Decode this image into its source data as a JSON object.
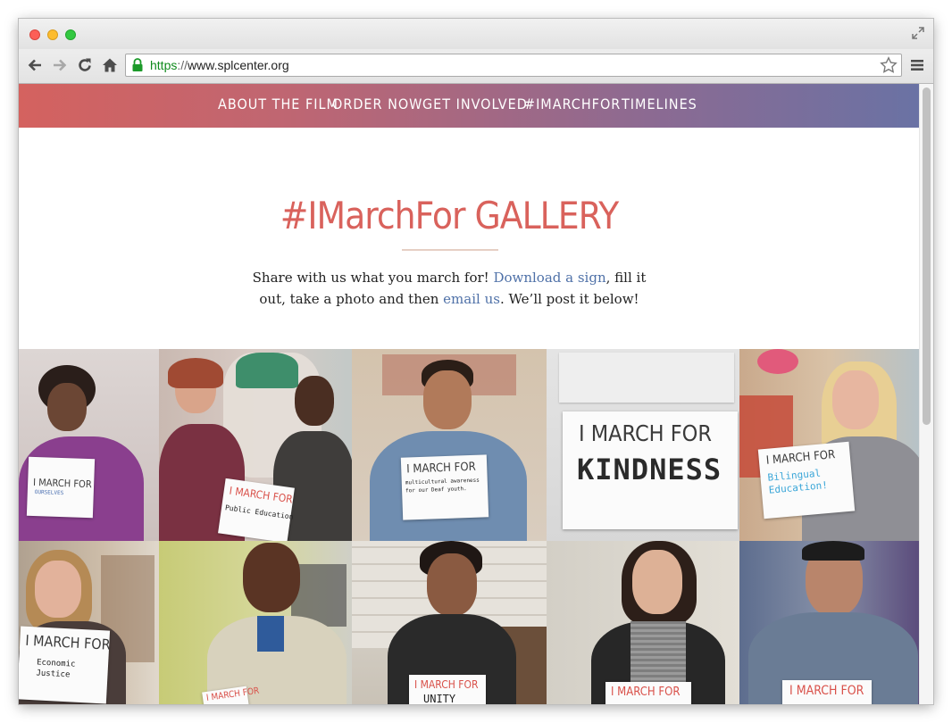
{
  "browser": {
    "url_scheme": "https",
    "url_sep": "://",
    "url_host": "www.splcenter.org"
  },
  "nav": {
    "items": [
      {
        "label": "ABOUT THE FILM"
      },
      {
        "label": "ORDER NOW"
      },
      {
        "label": "GET INVOLVED"
      },
      {
        "label": "#IMARCHFOR"
      },
      {
        "label": "TIMELINES"
      }
    ]
  },
  "hero": {
    "title": "#IMarchFor GALLERY",
    "intro_1": "Share with us what you march for! ",
    "intro_link_1": "Download a sign",
    "intro_2": ", fill it out, take a photo and then ",
    "intro_link_2": "email us",
    "intro_3": ". We’ll post it below!"
  },
  "gallery": {
    "photos": [
      {
        "sign_heading": "I MARCH FOR",
        "sign_text": "OURSELVES"
      },
      {
        "sign_heading": "I MARCH FOR",
        "sign_text": "Public Education"
      },
      {
        "sign_heading": "I MARCH FOR",
        "sign_text": "multicultural awareness for our Deaf youth."
      },
      {
        "sign_heading": "I MARCH FOR",
        "sign_text": "KINDNESS"
      },
      {
        "sign_heading": "I MARCH FOR",
        "sign_text": "Bilingual Education!"
      },
      {
        "sign_heading": "I MARCH FOR",
        "sign_text": "Economic Justice"
      },
      {
        "sign_heading": "I MARCH FOR",
        "sign_text": ""
      },
      {
        "sign_heading": "I MARCH FOR",
        "sign_text": "UNITY"
      },
      {
        "sign_heading": "I MARCH FOR",
        "sign_text": ""
      },
      {
        "sign_heading": "I MARCH FOR",
        "sign_text": ""
      }
    ]
  },
  "colors": {
    "nav_gradient_start": "#d4625f",
    "nav_gradient_end": "#6a72a4",
    "title_color": "#d9625c",
    "link_color": "#4f71a8"
  }
}
